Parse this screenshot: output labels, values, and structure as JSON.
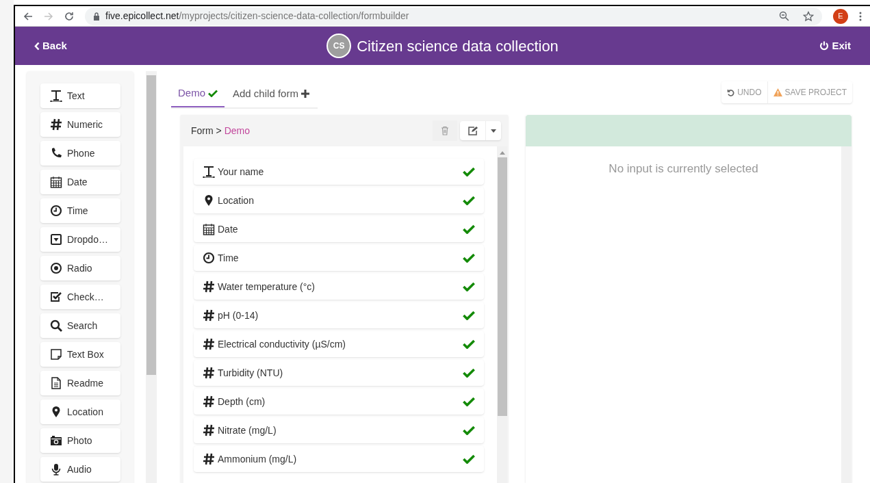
{
  "browser": {
    "url_host": "five.epicollect.net",
    "url_path": "/myprojects/citizen-science-data-collection/formbuilder",
    "profile_initial": "E"
  },
  "header": {
    "back": "Back",
    "project_initials": "CS",
    "title": "Citizen science data collection",
    "exit": "Exit"
  },
  "palette": [
    {
      "kind": "text",
      "label": "Text"
    },
    {
      "kind": "numeric",
      "label": "Numeric"
    },
    {
      "kind": "phone",
      "label": "Phone"
    },
    {
      "kind": "date",
      "label": "Date"
    },
    {
      "kind": "time",
      "label": "Time"
    },
    {
      "kind": "dropdown",
      "label": "Dropdo…"
    },
    {
      "kind": "radio",
      "label": "Radio"
    },
    {
      "kind": "checkbox",
      "label": "Check…"
    },
    {
      "kind": "search",
      "label": "Search"
    },
    {
      "kind": "textbox",
      "label": "Text Box"
    },
    {
      "kind": "readme",
      "label": "Readme"
    },
    {
      "kind": "location",
      "label": "Location"
    },
    {
      "kind": "photo",
      "label": "Photo"
    },
    {
      "kind": "audio",
      "label": "Audio"
    }
  ],
  "tabs": [
    {
      "label": "Demo",
      "selected": true,
      "valid": true
    },
    {
      "label": "Add child form",
      "selected": false,
      "valid": false
    }
  ],
  "actions": {
    "undo": "UNDO",
    "save": "SAVE PROJECT"
  },
  "form": {
    "breadcrumb_root": "Form >",
    "breadcrumb_current": "Demo",
    "inputs": [
      {
        "kind": "text",
        "label": "Your name",
        "valid": true
      },
      {
        "kind": "location",
        "label": "Location",
        "valid": true
      },
      {
        "kind": "date",
        "label": "Date",
        "valid": true
      },
      {
        "kind": "time",
        "label": "Time",
        "valid": true
      },
      {
        "kind": "numeric",
        "label": "Water temperature (°c)",
        "valid": true
      },
      {
        "kind": "numeric",
        "label": "pH (0-14)",
        "valid": true
      },
      {
        "kind": "numeric",
        "label": "Electrical conductivity (µS/cm)",
        "valid": true
      },
      {
        "kind": "numeric",
        "label": "Turbidity (NTU)",
        "valid": true
      },
      {
        "kind": "numeric",
        "label": "Depth (cm)",
        "valid": true
      },
      {
        "kind": "numeric",
        "label": "Nitrate (mg/L)",
        "valid": true
      },
      {
        "kind": "numeric",
        "label": "Ammonium (mg/L)",
        "valid": true
      }
    ]
  },
  "details": {
    "message": "No input is currently selected"
  }
}
